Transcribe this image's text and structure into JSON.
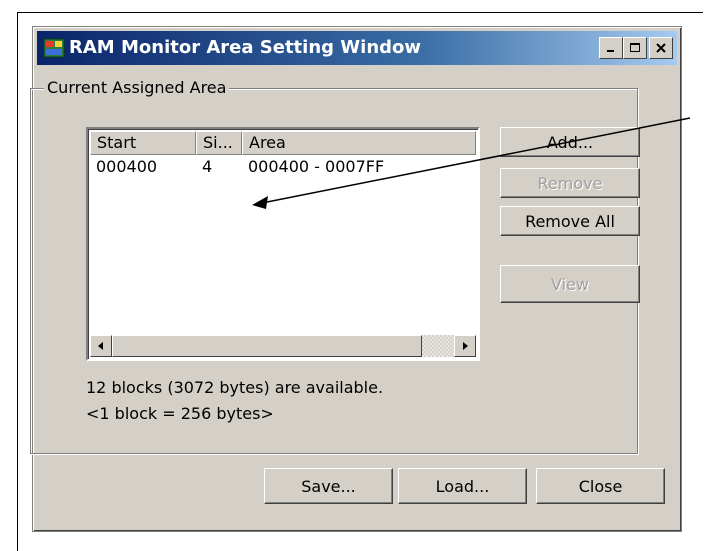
{
  "window": {
    "title": "RAM Monitor Area Setting Window",
    "buttons": {
      "minimize": "_",
      "maximize": "□",
      "close": "×"
    }
  },
  "group": {
    "label": "Current Assigned Area"
  },
  "listview": {
    "columns": [
      "Start",
      "Si...",
      "Area"
    ],
    "rows": [
      {
        "start": "000400",
        "size": "4",
        "area": "000400 - 0007FF"
      }
    ]
  },
  "side_buttons": {
    "add": "Add...",
    "remove": "Remove",
    "remove_all": "Remove All",
    "view": "View"
  },
  "info": {
    "available": "12 blocks (3072 bytes) are available.",
    "block_size": "<1 block = 256 bytes>"
  },
  "bottom_buttons": {
    "save": "Save...",
    "load": "Load...",
    "close": "Close"
  },
  "colors": {
    "title_bar_start": "#0a246a",
    "title_bar_end": "#a6caf0",
    "window_face": "#d4d0c8",
    "disabled_text": "#a0a0a0"
  }
}
